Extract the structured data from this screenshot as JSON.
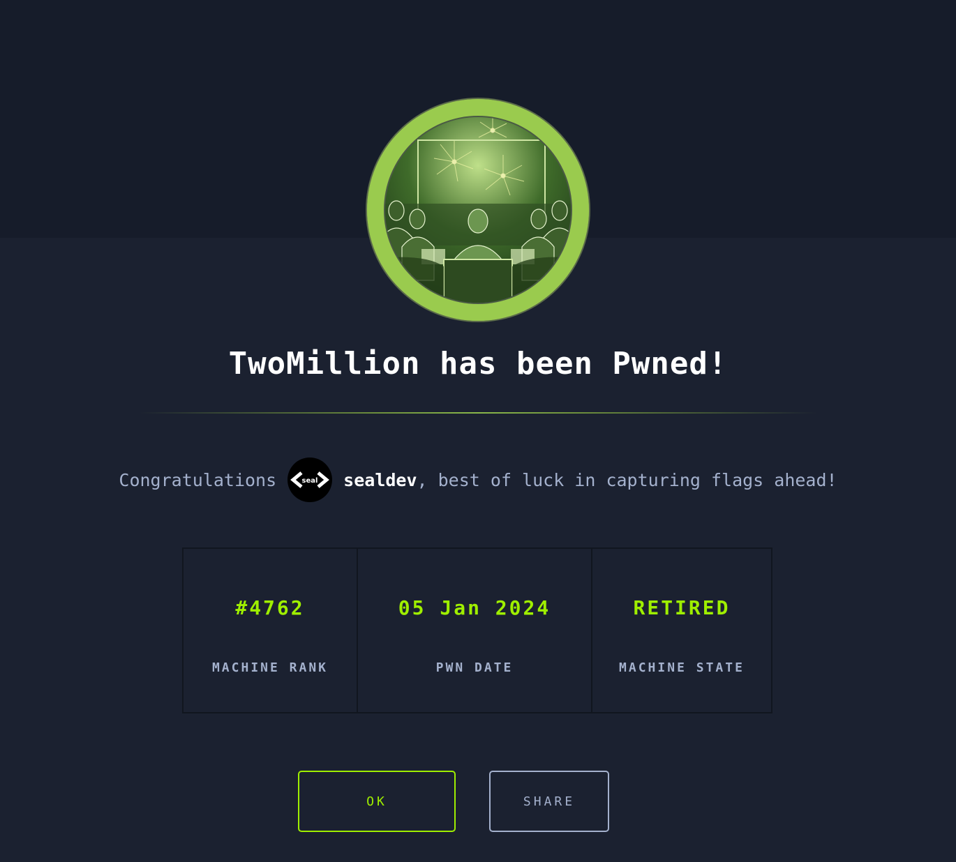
{
  "machine": {
    "name_title": "TwoMillion has been Pwned!",
    "badge_image": "machine-avatar-fireworks"
  },
  "congrats": {
    "prefix": "Congratulations",
    "avatar_text": "seal",
    "username": "sealdev",
    "suffix": ", best of luck in capturing flags ahead!"
  },
  "stats": [
    {
      "value": "#4762",
      "label": "MACHINE RANK"
    },
    {
      "value": "05 Jan 2024",
      "label": "PWN DATE"
    },
    {
      "value": "RETIRED",
      "label": "MACHINE STATE"
    }
  ],
  "buttons": {
    "ok": "OK",
    "share": "SHARE"
  },
  "colors": {
    "accent_green": "#9fef00",
    "badge_ring": "#9acb4e",
    "background": "#1b2130",
    "text_muted": "#a4b1cd"
  }
}
